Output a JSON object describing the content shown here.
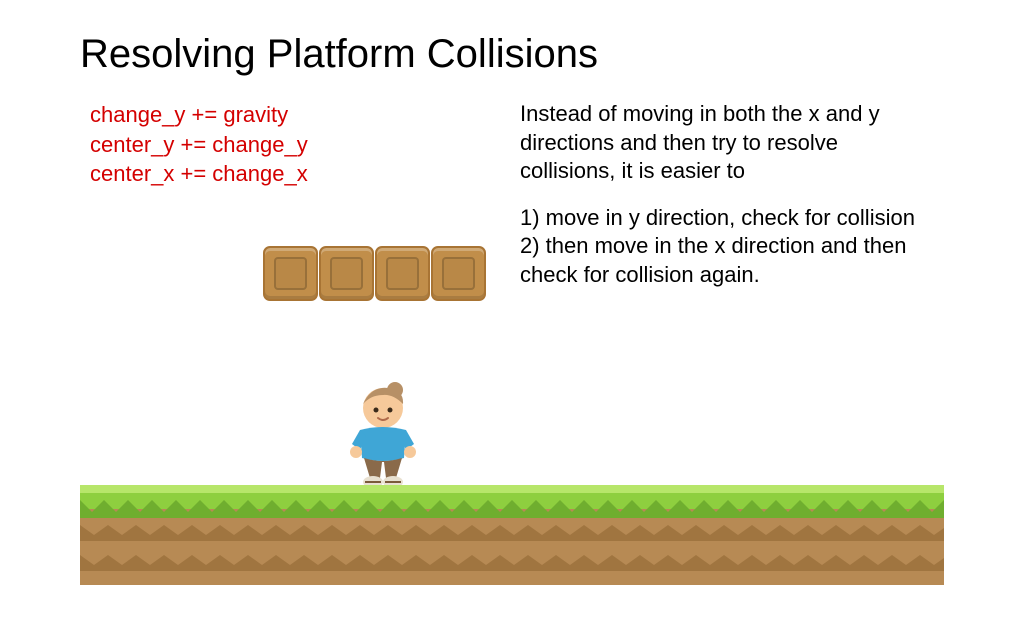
{
  "title": "Resolving Platform Collisions",
  "code": {
    "line1": "change_y += gravity",
    "line2": "center_y += change_y",
    "line3": "center_x += change_x"
  },
  "explain": {
    "intro": "Instead of moving in both the x and y directions and then try to resolve collisions, it is easier to",
    "step1": "1) move in y direction, check for collision",
    "step2": "2) then move in the x direction and then check for collision again."
  },
  "colors": {
    "code": "#d40000",
    "grass_light": "#b7e66a",
    "grass": "#8ecf3f",
    "grass_dark": "#6fae2f",
    "dirt": "#b78a54",
    "dirt_dark": "#a07540",
    "box": "#c18e4a",
    "box_border": "#a87434"
  }
}
